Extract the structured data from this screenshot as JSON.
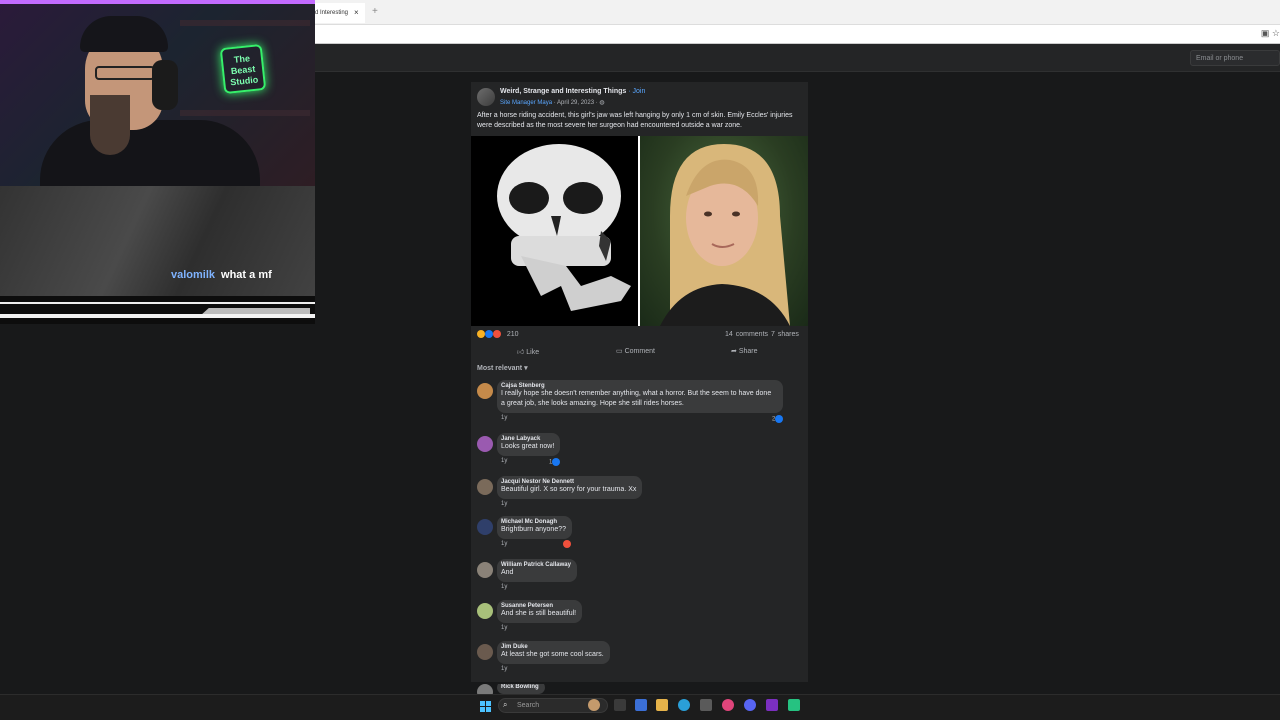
{
  "stream": {
    "chat_user": "valomilk",
    "chat_text": "what a mf",
    "neon_sign": "The Beast Studio"
  },
  "browser": {
    "tab_title": "d Interesting",
    "tab_close": "×",
    "new_tab": "+"
  },
  "fb_header": {
    "email_placeholder": "Email or phone"
  },
  "post": {
    "group_name": "Weird, Strange and Interesting Things",
    "join_label": "· Join",
    "author_role": "Site Manager Maya",
    "date": " · April 29, 2023 · ",
    "text": "After a horse riding accident, this girl's jaw was left hanging by only 1 cm of skin. Emily Eccles' injuries were described as the most severe her surgeon had encountered outside a war zone.",
    "reaction_count": "210",
    "comments_count": "14 comments",
    "shares_count": "7 shares",
    "like_label": "Like",
    "comment_label": "Comment",
    "share_label": "Share",
    "sort_label": "Most relevant"
  },
  "comments": [
    {
      "name": "Cajsa Stenberg",
      "text": "I really hope she doesn't remember anything, what a horror. But the seem to have done a great job, she looks amazing. Hope she still rides horses.",
      "age": "1y",
      "reacts": "2"
    },
    {
      "name": "Jane Labyack",
      "text": "Looks great now!",
      "age": "1y",
      "reacts": "1"
    },
    {
      "name": "Jacqui Nestor Ne Dennett",
      "text": "Beautiful girl. X so sorry for your trauma. Xx",
      "age": "1y",
      "reacts": ""
    },
    {
      "name": "Michael Mc Donagh",
      "text": "Brightburn anyone??",
      "age": "1y",
      "reacts": ""
    },
    {
      "name": "William Patrick Callaway",
      "text": "And",
      "age": "1y",
      "reacts": ""
    },
    {
      "name": "Susanne Petersen",
      "text": "And she is still beautiful!",
      "age": "1y",
      "reacts": ""
    },
    {
      "name": "Jim Duke",
      "text": "At least she got some cool scars.",
      "age": "1y",
      "reacts": ""
    },
    {
      "name": "Rick Bowling",
      "text": "",
      "age": "",
      "reacts": ""
    }
  ],
  "taskbar": {
    "search_placeholder": "Search"
  },
  "colors": {
    "fb_bg": "#18191a",
    "card_bg": "#242526",
    "link_blue": "#5aa7ff",
    "like_blue": "#1877f2"
  }
}
